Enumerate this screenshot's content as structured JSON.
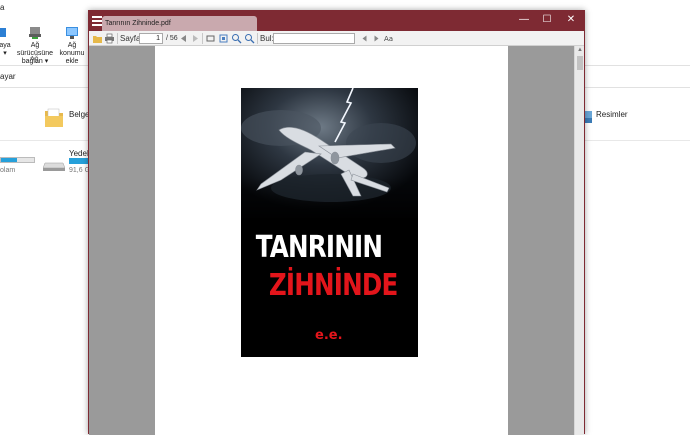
{
  "explorer": {
    "ribbon_top_char": "a",
    "ribbon_items": [
      {
        "label_line1": "aya",
        "label_line2": "▾"
      },
      {
        "label_line1": "Ağ sürücüsüne",
        "label_line2": "bağlan ▾"
      },
      {
        "label_line1": "Ağ konumu",
        "label_line2": "ekle"
      }
    ],
    "ribbon_group": "Ağ",
    "address_text": "ayar",
    "folder_documents": "Belgele",
    "folder_pictures": "Resimler",
    "drive1_status": "olam",
    "drive2_name": "Yedek D",
    "drive2_size": "91,6 GB"
  },
  "viewer": {
    "tab_title": "Tanrının Zihninde.pdf",
    "controls": {
      "minimize": "—",
      "maximize": "☐",
      "close": "✕"
    },
    "toolbar": {
      "page_label": "Sayfa:",
      "page_current": "1",
      "page_total": "/ 56",
      "find_label": "Bul:"
    }
  },
  "document": {
    "cover_title_line1": "TANRININ",
    "cover_title_line2": "ZİHNİNDE",
    "cover_author": "e.e."
  },
  "colors": {
    "titlebar": "#7e2a33",
    "tab": "#c9a9ae",
    "viewer_bg": "#9a9a9a",
    "cover_red": "#e3151b",
    "progress_blue": "#26a0da"
  }
}
